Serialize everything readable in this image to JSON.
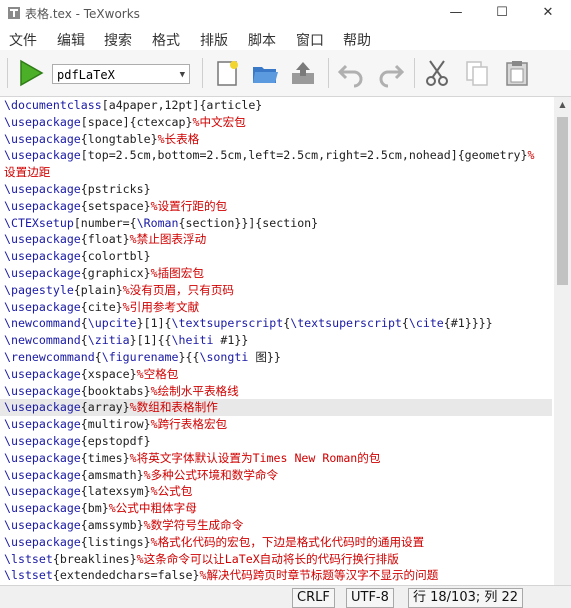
{
  "window": {
    "title": "表格.tex - TeXworks",
    "minimize": "—",
    "maximize": "☐",
    "close": "✕"
  },
  "menu": [
    "文件",
    "编辑",
    "搜索",
    "格式",
    "排版",
    "脚本",
    "窗口",
    "帮助"
  ],
  "toolbar": {
    "engine": "pdfLaTeX",
    "icons": [
      "typeset-play-icon",
      "new-document-icon",
      "open-folder-icon",
      "save-icon",
      "undo-icon",
      "redo-icon",
      "cut-icon",
      "copy-icon",
      "paste-icon"
    ]
  },
  "editor": {
    "highlighted_line": 18,
    "lines": [
      [
        [
          "k",
          "\\documentclass"
        ],
        [
          "t",
          "[a4paper,12pt]{article}"
        ]
      ],
      [
        [
          "k",
          "\\usepackage"
        ],
        [
          "t",
          "[space]{ctexcap}"
        ],
        [
          "c",
          "%中文宏包"
        ]
      ],
      [
        [
          "k",
          "\\usepackage"
        ],
        [
          "t",
          "{longtable}"
        ],
        [
          "c",
          "%长表格"
        ]
      ],
      [
        [
          "k",
          "\\usepackage"
        ],
        [
          "t",
          "[top=2.5cm,bottom=2.5cm,left=2.5cm,right=2.5cm,nohead]{geometry}"
        ],
        [
          "c",
          "%"
        ]
      ],
      [
        [
          "c",
          "设置边距"
        ]
      ],
      [
        [
          "k",
          "\\usepackage"
        ],
        [
          "t",
          "{pstricks}"
        ]
      ],
      [
        [
          "k",
          "\\usepackage"
        ],
        [
          "t",
          "{setspace}"
        ],
        [
          "c",
          "%设置行距的包"
        ]
      ],
      [
        [
          "k",
          "\\CTEXsetup"
        ],
        [
          "t",
          "[number={"
        ],
        [
          "k",
          "\\Roman"
        ],
        [
          "t",
          "{section}}]{section}"
        ]
      ],
      [
        [
          "k",
          "\\usepackage"
        ],
        [
          "t",
          "{float}"
        ],
        [
          "c",
          "%禁止图表浮动"
        ]
      ],
      [
        [
          "k",
          "\\usepackage"
        ],
        [
          "t",
          "{colortbl}"
        ]
      ],
      [
        [
          "k",
          "\\usepackage"
        ],
        [
          "t",
          "{graphicx}"
        ],
        [
          "c",
          "%插图宏包"
        ]
      ],
      [
        [
          "k",
          "\\pagestyle"
        ],
        [
          "t",
          "{plain}"
        ],
        [
          "c",
          "%没有页眉，只有页码"
        ]
      ],
      [
        [
          "k",
          "\\usepackage"
        ],
        [
          "t",
          "{cite}"
        ],
        [
          "c",
          "%引用参考文献"
        ]
      ],
      [
        [
          "k",
          "\\newcommand"
        ],
        [
          "t",
          "{"
        ],
        [
          "k",
          "\\upcite"
        ],
        [
          "t",
          "}[1]{"
        ],
        [
          "k",
          "\\textsuperscript"
        ],
        [
          "t",
          "{"
        ],
        [
          "k",
          "\\textsuperscript"
        ],
        [
          "t",
          "{"
        ],
        [
          "k",
          "\\cite"
        ],
        [
          "t",
          "{#1}}}}"
        ]
      ],
      [
        [
          "k",
          "\\newcommand"
        ],
        [
          "t",
          "{"
        ],
        [
          "k",
          "\\zitia"
        ],
        [
          "t",
          "}[1]{{"
        ],
        [
          "k",
          "\\heiti"
        ],
        [
          "t",
          " #1}}"
        ]
      ],
      [
        [
          "k",
          "\\renewcommand"
        ],
        [
          "t",
          "{"
        ],
        [
          "k",
          "\\figurename"
        ],
        [
          "t",
          "}{{"
        ],
        [
          "k",
          "\\songti"
        ],
        [
          "t",
          " 图}}"
        ]
      ],
      [
        [
          "k",
          "\\usepackage"
        ],
        [
          "t",
          "{xspace}"
        ],
        [
          "c",
          "%空格包"
        ]
      ],
      [
        [
          "k",
          "\\usepackage"
        ],
        [
          "t",
          "{booktabs}"
        ],
        [
          "c",
          "%绘制水平表格线"
        ]
      ],
      [
        [
          "k",
          "\\usepackage"
        ],
        [
          "t",
          "{array}"
        ],
        [
          "c",
          "%数组和表格制作"
        ]
      ],
      [
        [
          "k",
          "\\usepackage"
        ],
        [
          "t",
          "{multirow}"
        ],
        [
          "c",
          "%跨行表格宏包"
        ]
      ],
      [
        [
          "k",
          "\\usepackage"
        ],
        [
          "t",
          "{epstopdf}"
        ]
      ],
      [
        [
          "k",
          "\\usepackage"
        ],
        [
          "t",
          "{times}"
        ],
        [
          "c",
          "%将英文字体默认设置为Times New Roman的包"
        ]
      ],
      [
        [
          "k",
          "\\usepackage"
        ],
        [
          "t",
          "{amsmath}"
        ],
        [
          "c",
          "%多种公式环境和数学命令"
        ]
      ],
      [
        [
          "k",
          "\\usepackage"
        ],
        [
          "t",
          "{latexsym}"
        ],
        [
          "c",
          "%公式包"
        ]
      ],
      [
        [
          "k",
          "\\usepackage"
        ],
        [
          "t",
          "{bm}"
        ],
        [
          "c",
          "%公式中粗体字母"
        ]
      ],
      [
        [
          "k",
          "\\usepackage"
        ],
        [
          "t",
          "{amssymb}"
        ],
        [
          "c",
          "%数学符号生成命令"
        ]
      ],
      [
        [
          "k",
          "\\usepackage"
        ],
        [
          "t",
          "{listings}"
        ],
        [
          "c",
          "%格式化代码的宏包，下边是格式化代码时的通用设置"
        ]
      ],
      [
        [
          "k",
          "\\lstset"
        ],
        [
          "t",
          "{breaklines}"
        ],
        [
          "c",
          "%这条命令可以让LaTeX自动将长的代码行换行排版"
        ]
      ],
      [
        [
          "k",
          "\\lstset"
        ],
        [
          "t",
          "{extendedchars=false}"
        ],
        [
          "c",
          "%解决代码跨页时章节标题等汉字不显示的问题"
        ]
      ]
    ]
  },
  "status": {
    "line_ending": "CRLF",
    "encoding": "UTF-8",
    "position": "行 18/103; 列 22"
  }
}
